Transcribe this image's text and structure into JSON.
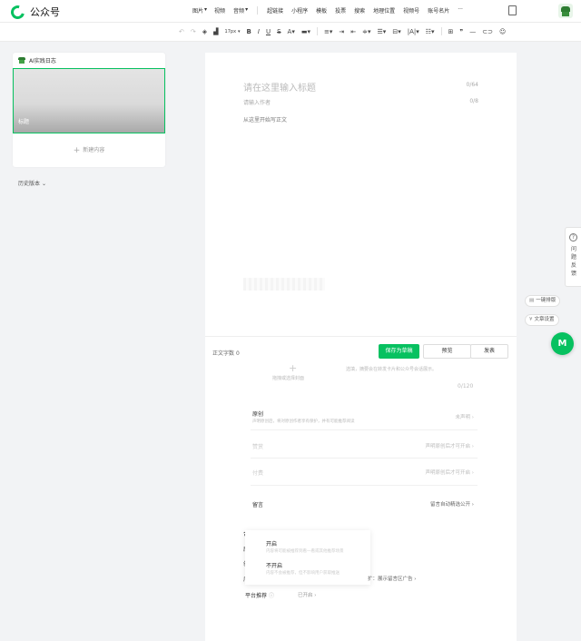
{
  "header": {
    "brand": "公众号",
    "menu": [
      "图片",
      "视频",
      "音频",
      "超链接",
      "小程序",
      "模板",
      "投票",
      "搜索",
      "地理位置",
      "视频号",
      "账号名片",
      "···"
    ]
  },
  "toolbar": {
    "font_size": "17px",
    "items": [
      "undo-icon",
      "redo-icon",
      "clear-format-icon",
      "format-brush-icon",
      "bold-icon",
      "italic-icon",
      "underline-icon",
      "strikethrough-icon",
      "font-color-icon",
      "background-color-icon",
      "align-icon",
      "indent-icon",
      "line-spacing-icon",
      "paragraph-spacing-icon",
      "letter-spacing-icon",
      "list-icon",
      "table-icon",
      "quote-icon",
      "divider-icon",
      "link-icon",
      "emoji-icon"
    ]
  },
  "sidebar": {
    "article_title": "AI实践日志",
    "thumbnail_label": "标题",
    "new_content": "新建内容",
    "history": "历史版本"
  },
  "editor": {
    "title_placeholder": "请在这里输入标题",
    "title_count": "0/64",
    "author_placeholder": "请输入作者",
    "author_count": "0/8",
    "body_placeholder": "从这里开始写正文"
  },
  "actions": {
    "word_count_label": "正文字数",
    "word_count": "0",
    "save": "保存为草稿",
    "preview": "预览",
    "publish": "发表"
  },
  "cover": {
    "label": "拖拽或选择封面",
    "description": "选填，摘要会在转发卡片和公众号会话展示。",
    "count": "0/120"
  },
  "settings": {
    "original_label": "原创",
    "original_desc": "声明原创后，将对原创作者享有保护，并有可能推荐阅读",
    "original_value": "未声明",
    "reward_label": "赞赏",
    "reward_value": "声明原创后才可开启",
    "paid_label": "付费",
    "paid_value": "声明原创后才可开启",
    "comments_label": "留言",
    "comments_value": "留言自动精选公开"
  },
  "popup": {
    "option1_title": "开启",
    "option1_desc": "内容将可能被推荐到看一看或其他推荐场景",
    "option2_title": "不开启",
    "option2_desc": "内容不会被推荐，但不影响用户获取推送"
  },
  "ads": {
    "text": "扩：展示留言区广告"
  },
  "platform": {
    "label": "平台推荐",
    "value": "已开启"
  },
  "right_panel": {
    "feedback": "问题反馈",
    "one_click": "一键排版",
    "article_settings": "文章设置",
    "avatar_letter": "M"
  }
}
